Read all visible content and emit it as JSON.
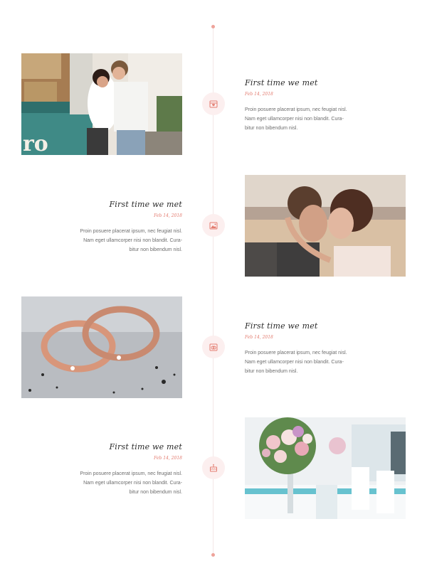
{
  "colors": {
    "accent": "#e37c70",
    "marker_bg": "#fcefef",
    "line": "#f3e6e6",
    "title": "#2b2b2b",
    "body_text": "#6e6e6e"
  },
  "timeline": {
    "items": [
      {
        "title": "First time we met",
        "date": "Feb 14, 2018",
        "description": "Proin posuere placerat ipsum, nec feugiat nisl.\nNam eget ullamcorper nisi non blandit. Cura-\nbitur non bibendum nisl.",
        "icon": "calendar-heart-icon"
      },
      {
        "title": "First time we met",
        "date": "Feb 14, 2018",
        "description": "Proin posuere placerat ipsum, nec feugiat nisl.\nNam eget ullamcorper nisi non blandit. Cura-\nbitur non bibendum nisl.",
        "icon": "photo-heart-icon"
      },
      {
        "title": "First time we met",
        "date": "Feb 14, 2018",
        "description": "Proin posuere placerat ipsum, nec feugiat nisl.\nNam eget ullamcorper nisi non blandit. Cura-\nbitur non bibendum nisl.",
        "icon": "rings-icon"
      },
      {
        "title": "First time we met",
        "date": "Feb 14, 2018",
        "description": "Proin posuere placerat ipsum, nec feugiat nisl.\nNam eget ullamcorper nisi non blandit. Cura-\nbitur non bibendum nisl.",
        "icon": "cake-icon"
      }
    ]
  }
}
